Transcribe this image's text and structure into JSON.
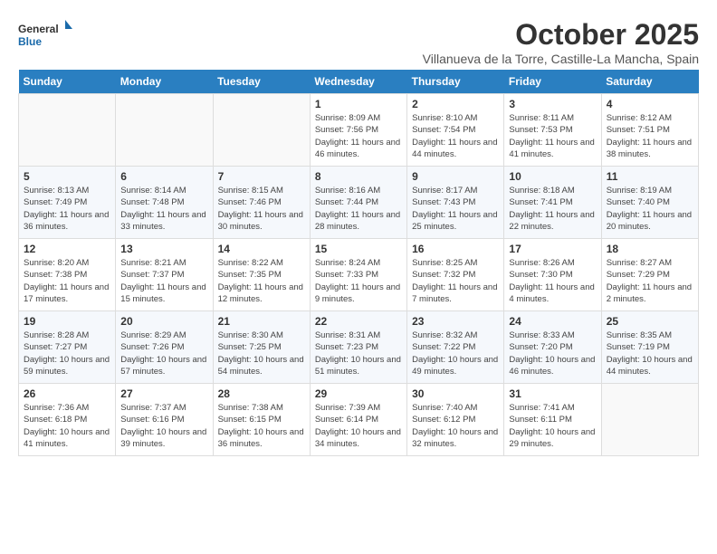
{
  "header": {
    "logo_general": "General",
    "logo_blue": "Blue",
    "month": "October 2025",
    "subtitle": "Villanueva de la Torre, Castille-La Mancha, Spain"
  },
  "days_of_week": [
    "Sunday",
    "Monday",
    "Tuesday",
    "Wednesday",
    "Thursday",
    "Friday",
    "Saturday"
  ],
  "weeks": [
    [
      {
        "day": "",
        "info": ""
      },
      {
        "day": "",
        "info": ""
      },
      {
        "day": "",
        "info": ""
      },
      {
        "day": "1",
        "info": "Sunrise: 8:09 AM\nSunset: 7:56 PM\nDaylight: 11 hours and 46 minutes."
      },
      {
        "day": "2",
        "info": "Sunrise: 8:10 AM\nSunset: 7:54 PM\nDaylight: 11 hours and 44 minutes."
      },
      {
        "day": "3",
        "info": "Sunrise: 8:11 AM\nSunset: 7:53 PM\nDaylight: 11 hours and 41 minutes."
      },
      {
        "day": "4",
        "info": "Sunrise: 8:12 AM\nSunset: 7:51 PM\nDaylight: 11 hours and 38 minutes."
      }
    ],
    [
      {
        "day": "5",
        "info": "Sunrise: 8:13 AM\nSunset: 7:49 PM\nDaylight: 11 hours and 36 minutes."
      },
      {
        "day": "6",
        "info": "Sunrise: 8:14 AM\nSunset: 7:48 PM\nDaylight: 11 hours and 33 minutes."
      },
      {
        "day": "7",
        "info": "Sunrise: 8:15 AM\nSunset: 7:46 PM\nDaylight: 11 hours and 30 minutes."
      },
      {
        "day": "8",
        "info": "Sunrise: 8:16 AM\nSunset: 7:44 PM\nDaylight: 11 hours and 28 minutes."
      },
      {
        "day": "9",
        "info": "Sunrise: 8:17 AM\nSunset: 7:43 PM\nDaylight: 11 hours and 25 minutes."
      },
      {
        "day": "10",
        "info": "Sunrise: 8:18 AM\nSunset: 7:41 PM\nDaylight: 11 hours and 22 minutes."
      },
      {
        "day": "11",
        "info": "Sunrise: 8:19 AM\nSunset: 7:40 PM\nDaylight: 11 hours and 20 minutes."
      }
    ],
    [
      {
        "day": "12",
        "info": "Sunrise: 8:20 AM\nSunset: 7:38 PM\nDaylight: 11 hours and 17 minutes."
      },
      {
        "day": "13",
        "info": "Sunrise: 8:21 AM\nSunset: 7:37 PM\nDaylight: 11 hours and 15 minutes."
      },
      {
        "day": "14",
        "info": "Sunrise: 8:22 AM\nSunset: 7:35 PM\nDaylight: 11 hours and 12 minutes."
      },
      {
        "day": "15",
        "info": "Sunrise: 8:24 AM\nSunset: 7:33 PM\nDaylight: 11 hours and 9 minutes."
      },
      {
        "day": "16",
        "info": "Sunrise: 8:25 AM\nSunset: 7:32 PM\nDaylight: 11 hours and 7 minutes."
      },
      {
        "day": "17",
        "info": "Sunrise: 8:26 AM\nSunset: 7:30 PM\nDaylight: 11 hours and 4 minutes."
      },
      {
        "day": "18",
        "info": "Sunrise: 8:27 AM\nSunset: 7:29 PM\nDaylight: 11 hours and 2 minutes."
      }
    ],
    [
      {
        "day": "19",
        "info": "Sunrise: 8:28 AM\nSunset: 7:27 PM\nDaylight: 10 hours and 59 minutes."
      },
      {
        "day": "20",
        "info": "Sunrise: 8:29 AM\nSunset: 7:26 PM\nDaylight: 10 hours and 57 minutes."
      },
      {
        "day": "21",
        "info": "Sunrise: 8:30 AM\nSunset: 7:25 PM\nDaylight: 10 hours and 54 minutes."
      },
      {
        "day": "22",
        "info": "Sunrise: 8:31 AM\nSunset: 7:23 PM\nDaylight: 10 hours and 51 minutes."
      },
      {
        "day": "23",
        "info": "Sunrise: 8:32 AM\nSunset: 7:22 PM\nDaylight: 10 hours and 49 minutes."
      },
      {
        "day": "24",
        "info": "Sunrise: 8:33 AM\nSunset: 7:20 PM\nDaylight: 10 hours and 46 minutes."
      },
      {
        "day": "25",
        "info": "Sunrise: 8:35 AM\nSunset: 7:19 PM\nDaylight: 10 hours and 44 minutes."
      }
    ],
    [
      {
        "day": "26",
        "info": "Sunrise: 7:36 AM\nSunset: 6:18 PM\nDaylight: 10 hours and 41 minutes."
      },
      {
        "day": "27",
        "info": "Sunrise: 7:37 AM\nSunset: 6:16 PM\nDaylight: 10 hours and 39 minutes."
      },
      {
        "day": "28",
        "info": "Sunrise: 7:38 AM\nSunset: 6:15 PM\nDaylight: 10 hours and 36 minutes."
      },
      {
        "day": "29",
        "info": "Sunrise: 7:39 AM\nSunset: 6:14 PM\nDaylight: 10 hours and 34 minutes."
      },
      {
        "day": "30",
        "info": "Sunrise: 7:40 AM\nSunset: 6:12 PM\nDaylight: 10 hours and 32 minutes."
      },
      {
        "day": "31",
        "info": "Sunrise: 7:41 AM\nSunset: 6:11 PM\nDaylight: 10 hours and 29 minutes."
      },
      {
        "day": "",
        "info": ""
      }
    ]
  ]
}
